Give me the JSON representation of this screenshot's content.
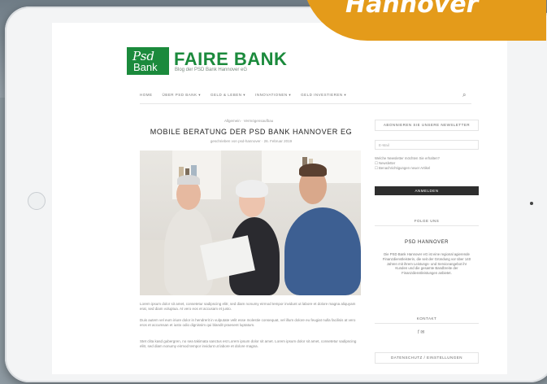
{
  "badge": {
    "text": "Hannover"
  },
  "logo": {
    "top": "Psd",
    "bottom": "Bank"
  },
  "site": {
    "name": "FAIRE BANK",
    "tagline": "Blog der PSD Bank Hannover eG"
  },
  "nav": {
    "items": [
      "HOME",
      "ÜBER PSD BANK ▾",
      "GELD & LEBEN ▾",
      "INNOVATIONEN ▾",
      "GELD INVESTIEREN ▾"
    ],
    "search_icon": "search-icon"
  },
  "post": {
    "breadcrumb": "Allgemein  ·  Vermögensaufbau",
    "title": "MOBILE BERATUNG DER PSD BANK HANNOVER EG",
    "meta": "geschrieben von psd-hannover    ·    26. Februar 2019",
    "paragraphs": [
      "Lorem ipsum dolor sit amet, consetetur sadipscing elitr, sed diam nonumy eirmod tempor invidunt ut labore et dolore magna aliquyam erat, sed diam voluptua. At vero eos et accusam et justo.",
      "Duis autem vel eum iriure dolor in hendrerit in vulputate velit esse molestie consequat, vel illum dolore eu feugiat nulla facilisis at vero eros et accumsan et iusto odio dignissim qui blandit praesent luptatum.",
      "Stet clita kasd gubergren, no sea takimata sanctus est Lorem ipsum dolor sit amet. Lorem ipsum dolor sit amet, consetetur sadipscing elitr, sed diam nonumy eirmod tempor invidunt ut labore et dolore magna."
    ]
  },
  "sidebar": {
    "newsletter_heading": "ABONNIEREN SIE UNSERE NEWSLETTER",
    "email_placeholder": "E-Mail",
    "consent_text": "Welche Newsletter möchten Sie erhalten?",
    "options": [
      "Newsletter",
      "Benachrichtigungen neuer Artikel"
    ],
    "subscribe_label": "ANMELDEN",
    "follow_label": "FOLGE UNS",
    "psd_heading": "PSD HANNOVER",
    "psd_text": "Die PSD Bank Hannover eG ist eine regional agierende Finanzdienstleisterin, die seit der Gründung vor über 140 Jahren mit ihrem Leistungs- und Serviceangebot ihr Kunden und die gesamte Bandbreite der Finanzdienstleistungen anbietet.",
    "contact_label": "KONTAKT",
    "privacy_label": "DATENSCHUTZ / EINSTELLUNGEN"
  }
}
